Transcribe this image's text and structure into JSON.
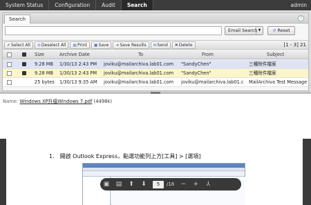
{
  "nav": {
    "items": [
      "System Status",
      "Configuration",
      "Audit",
      "Search"
    ],
    "active": "Search",
    "user": "admin"
  },
  "search": {
    "tab": "Search",
    "query_value": "",
    "query_placeholder": "",
    "email_search_label": "Email Search",
    "reset_label": "Reset"
  },
  "toolbar": {
    "select_all": "Select All",
    "deselect_all": "Deselect All",
    "print": "Print",
    "save": "Save",
    "save_results": "Save Results",
    "send": "Send",
    "delete": "Delete",
    "page_indicator": "[1 - 3] 21"
  },
  "table": {
    "columns": [
      "Size",
      "Archive Date",
      "To",
      "From",
      "Subject"
    ],
    "rows": [
      {
        "size": "9.28 MB",
        "date": "1/30/13 2:43 PM",
        "to": "joviku@mailarchiva.lab01.com",
        "from": "\"SandyChen\"",
        "subject": "三種附件檔案",
        "state": "sel",
        "attachment": true
      },
      {
        "size": "9.28 MB",
        "date": "1/30/13 2:43 PM",
        "to": "joviku@mailarchiva.lab01.com",
        "from": "\"SandyChen\"",
        "subject": "三種附件檔案",
        "state": "hl",
        "attachment": true
      },
      {
        "size": "25 bytes",
        "date": "1/30/13 9:35 AM",
        "to": "joviku@mailarchiva.lab01.com",
        "from": "joviku@mailarchiva.lab01.c",
        "subject": "MailArchiva Test Message",
        "state": "plain",
        "attachment": false
      }
    ]
  },
  "preview": {
    "name_label": "Name:",
    "file_name": "Windows XP升級Windows 7.pdf",
    "file_size": "(4498k)",
    "step_number": "1.",
    "step_text": "開啟 Outlook Express，點選功能列上方[工具] > [選項]",
    "current_page": "5",
    "total_pages": "/18"
  },
  "icons": {
    "attachment": "attachment-icon",
    "help": "help-icon"
  },
  "colors": {
    "nav_bg": "#3c3c3c",
    "row_selected": "#dfe4f4",
    "row_highlight": "#fbf5c9",
    "pdf_bar": "#282828"
  }
}
